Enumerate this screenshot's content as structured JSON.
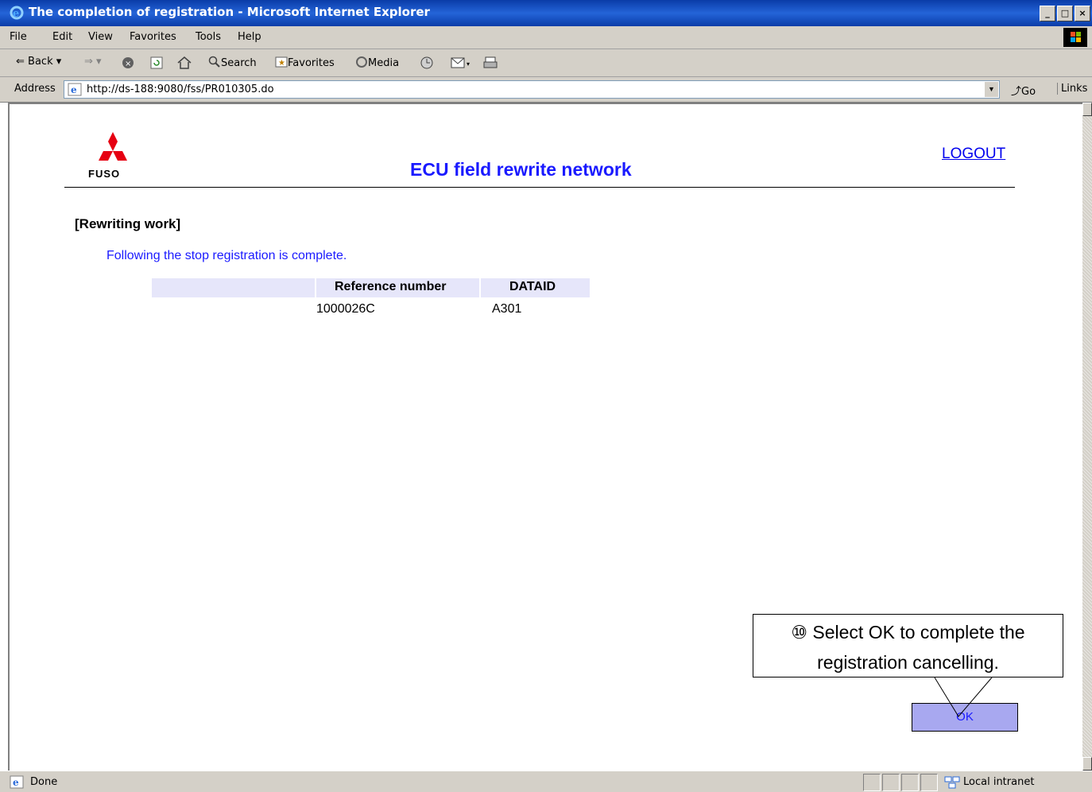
{
  "window": {
    "title": "The completion of registration - Microsoft Internet Explorer",
    "minimize_label": "_",
    "maximize_label": "□",
    "close_label": "×"
  },
  "menu": {
    "items": [
      "File",
      "Edit",
      "View",
      "Favorites",
      "Tools",
      "Help"
    ]
  },
  "toolbar": {
    "back_label": "Back",
    "search_label": "Search",
    "favorites_label": "Favorites",
    "media_label": "Media"
  },
  "address": {
    "label": "Address",
    "url": "http://ds-188:9080/fss/PR010305.do",
    "go_label": "Go",
    "links_label": "Links"
  },
  "page": {
    "logo_text": "FUSO",
    "title": "ECU field rewrite network",
    "logout_label": "LOGOUT",
    "section_title": "[Rewriting work]",
    "message": "Following the stop registration is complete.",
    "table": {
      "columns": [
        "Reference number",
        "DATAID"
      ],
      "rows": [
        [
          "1000026C",
          "A301"
        ]
      ]
    },
    "ok_label": "OK"
  },
  "callout": {
    "line1": "⑩ Select OK to complete the",
    "line2": "registration cancelling."
  },
  "status": {
    "text": "Done",
    "zone": "Local intranet"
  },
  "colors": {
    "title_blue": "#1a1aff",
    "header_lavender": "#e6e6fa",
    "ok_button": "#a8a8f0",
    "logo_red": "#e60012"
  }
}
